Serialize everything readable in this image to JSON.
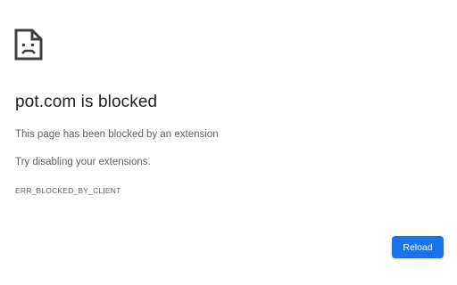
{
  "error_page": {
    "icon": "sad-page-icon",
    "headline": "pot.com is blocked",
    "message": "This page has been blocked by an extension",
    "suggestion": "Try disabling your extensions.",
    "error_code": "ERR_BLOCKED_BY_CLIENT",
    "reload_label": "Reload"
  },
  "colors": {
    "heading_text": "#202124",
    "body_text": "#5f6368",
    "button_bg": "#1a73e8",
    "button_text": "#ffffff",
    "background": "#ffffff"
  }
}
